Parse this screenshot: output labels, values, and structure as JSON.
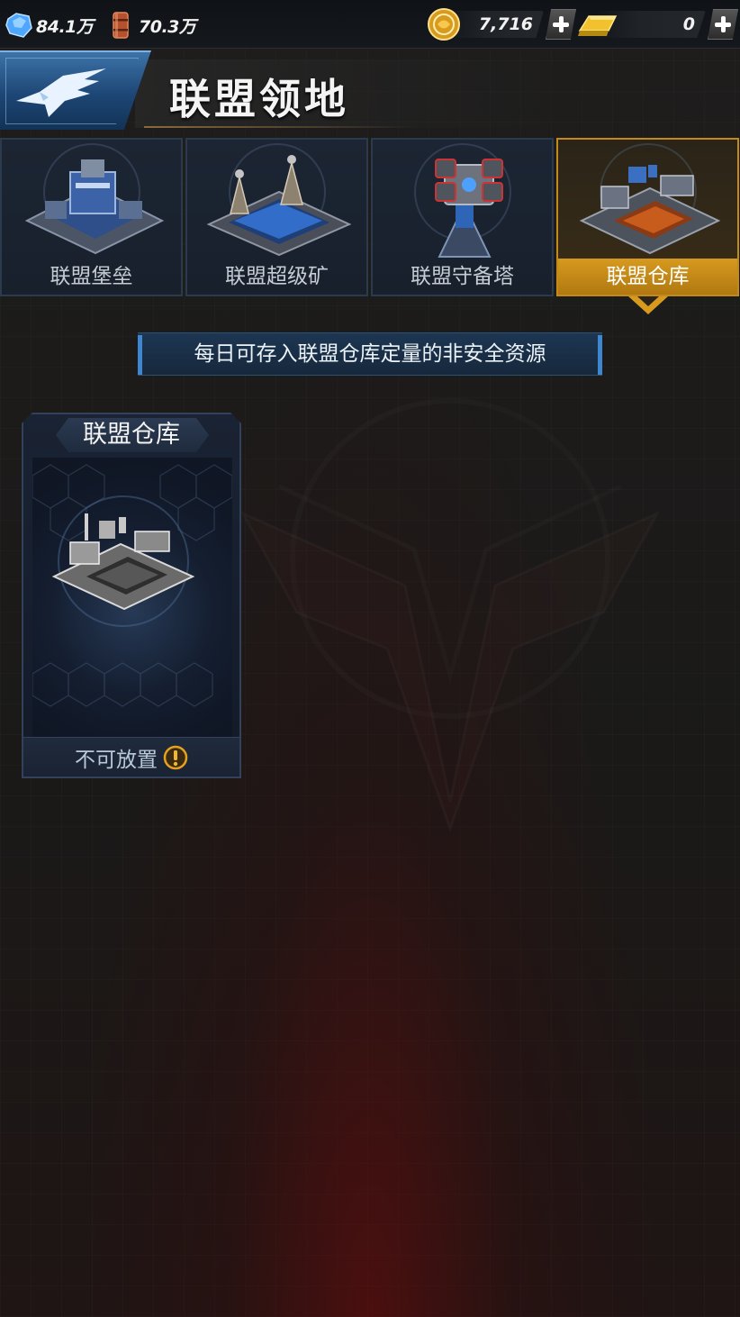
{
  "resources": {
    "crystal": {
      "value": "84.1万",
      "icon": "crystal-icon"
    },
    "oil": {
      "value": "70.3万",
      "icon": "oil-barrel-icon"
    }
  },
  "currency": {
    "gold_coin": {
      "value": "7,716",
      "icon": "gold-coin-icon"
    },
    "gold_bar": {
      "value": "0",
      "icon": "gold-bar-icon"
    }
  },
  "header": {
    "title": "联盟领地",
    "back_icon": "eagle-icon"
  },
  "tabs": [
    {
      "label": "联盟堡垒",
      "active": false
    },
    {
      "label": "联盟超级矿",
      "active": false
    },
    {
      "label": "联盟守备塔",
      "active": false
    },
    {
      "label": "联盟仓库",
      "active": true
    }
  ],
  "notice": {
    "text": "每日可存入联盟仓库定量的非安全资源"
  },
  "card": {
    "title": "联盟仓库",
    "status": "不可放置",
    "status_icon": "warning-icon"
  },
  "colors": {
    "accent_gold": "#d79a1f",
    "tab_bg": "#1c2533",
    "notice_blue": "#3e86d0",
    "background": "#1b1a19"
  }
}
